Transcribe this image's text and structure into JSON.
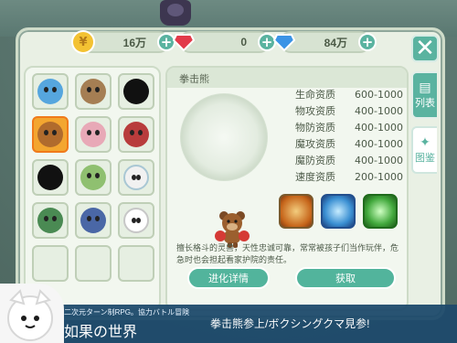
{
  "currencies": [
    {
      "icon": "coin-icon",
      "value": "16万"
    },
    {
      "icon": "red-gem-icon",
      "value": "0"
    },
    {
      "icon": "blue-diamond-icon",
      "value": "84万"
    }
  ],
  "tabs": {
    "list": "列表",
    "codex": "图鉴"
  },
  "detail": {
    "name": "拳击熊",
    "stats": [
      {
        "label": "生命资质",
        "value": "600-1000"
      },
      {
        "label": "物攻资质",
        "value": "400-1000"
      },
      {
        "label": "物防资质",
        "value": "400-1000"
      },
      {
        "label": "魔攻资质",
        "value": "400-1000"
      },
      {
        "label": "魔防资质",
        "value": "400-1000"
      },
      {
        "label": "速度资质",
        "value": "200-1000"
      }
    ],
    "description": "擅长格斗的灵兽，天性忠诚可靠，常常被孩子们当作玩伴，危急时也会担起看家护院的责任。",
    "buttons": {
      "evolve": "进化详情",
      "obtain": "获取"
    }
  },
  "banner": {
    "top": "二次元ターン制RPG。協力バトル冒険",
    "title": "如果の世界",
    "right": "拳击熊参上/ボクシングクマ見参!"
  }
}
